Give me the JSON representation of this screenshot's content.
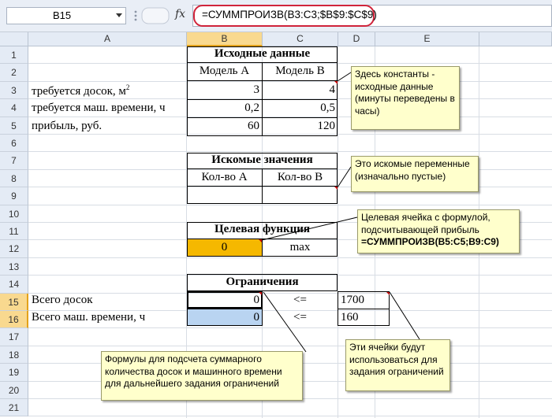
{
  "formula_bar": {
    "name_box": "B15",
    "fx_label": "fx",
    "formula": "=СУММПРОИЗВ(B3:C3;$B$9:$C$9)"
  },
  "columns": [
    "A",
    "B",
    "C",
    "D",
    "E"
  ],
  "rows": [
    "1",
    "2",
    "3",
    "4",
    "5",
    "6",
    "7",
    "8",
    "9",
    "10",
    "11",
    "12",
    "13",
    "14",
    "15",
    "16",
    "17",
    "18",
    "19",
    "20",
    "21"
  ],
  "sheet": {
    "title_initial": "Исходные данные",
    "model_a": "Модель A",
    "model_b": "Модель B",
    "r3_label": "требуется досок, м",
    "r3_sup": "2",
    "r3_b": "3",
    "r3_c": "4",
    "r4_label": "требуется маш. времени, ч",
    "r4_b": "0,2",
    "r4_c": "0,5",
    "r5_label": "прибыль, руб.",
    "r5_b": "60",
    "r5_c": "120",
    "title_unknowns": "Искомые значения",
    "qty_a": "Кол-во A",
    "qty_b": "Кол-во B",
    "title_target": "Целевая функция",
    "target_value": "0",
    "target_goal": "max",
    "title_constraints": "Ограничения",
    "r15_label": "Всего досок",
    "r15_b": "0",
    "r15_c": "<=",
    "r15_d": "1700",
    "r16_label": "Всего маш. времени, ч",
    "r16_b": "0",
    "r16_c": "<=",
    "r16_d": "160"
  },
  "callouts": {
    "constants": "Здесь константы - исходные данные (минуты переведены в часы)",
    "unknowns": "Это искомые переменные (изначально пустые)",
    "target_text": "Целевая ячейка с формулой, подсчитывающей прибыль",
    "target_formula": "=СУММПРОИЗВ(B5:C5;B9:C9)",
    "formulas": "Формулы для подсчета суммарного количества досок и машинного времени для дальнейшего задания ограничений",
    "limits": "Эти ячейки будут использоваться для задания ограничений"
  },
  "colors": {
    "target_fill": "#f5b800",
    "selected_fill": "#b9d4f1",
    "callout_fill": "#ffffcc",
    "formula_oval": "#d0233a"
  }
}
